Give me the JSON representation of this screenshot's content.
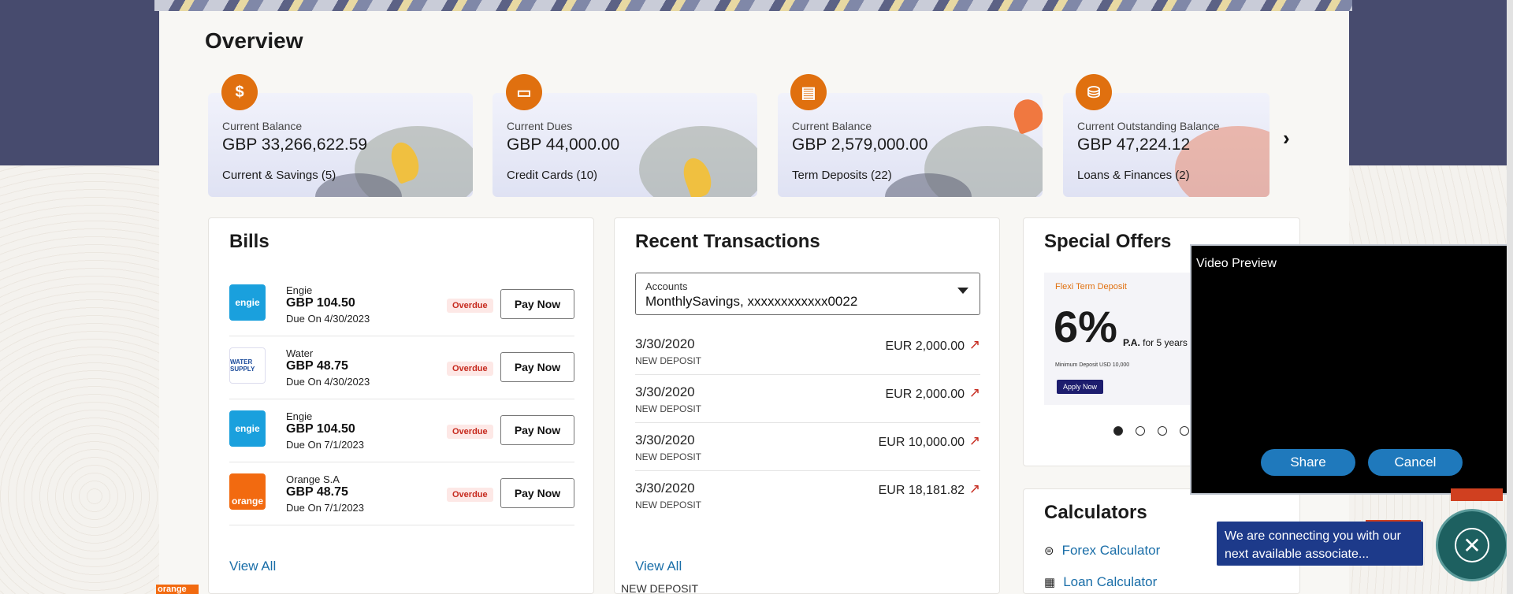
{
  "overview": {
    "title": "Overview",
    "cards": [
      {
        "icon": "dollar-coin-icon",
        "label": "Current Balance",
        "amount": "GBP 33,266,622.59",
        "category": "Current & Savings (5)"
      },
      {
        "icon": "credit-card-icon",
        "label": "Current Dues",
        "amount": "GBP 44,000.00",
        "category": "Credit Cards (10)"
      },
      {
        "icon": "term-deposit-icon",
        "label": "Current Balance",
        "amount": "GBP 2,579,000.00",
        "category": "Term Deposits (22)"
      },
      {
        "icon": "loan-hand-icon",
        "label": "Current Outstanding Balance",
        "amount": "GBP 47,224.12",
        "category": "Loans & Finances (2)"
      }
    ],
    "next_icon": "chevron-right-icon"
  },
  "bills": {
    "title": "Bills",
    "overdue_label": "Overdue",
    "pay_label": "Pay Now",
    "view_all": "View All",
    "items": [
      {
        "name": "Engie",
        "amount": "GBP 104.50",
        "due": "Due On 4/30/2023",
        "logo": "engie",
        "logo_color": "#1aa0dd"
      },
      {
        "name": "Water",
        "amount": "GBP 48.75",
        "due": "Due On 4/30/2023",
        "logo": "WATER SUPPLY",
        "logo_color": "#ffffff"
      },
      {
        "name": "Engie",
        "amount": "GBP 104.50",
        "due": "Due On 7/1/2023",
        "logo": "engie",
        "logo_color": "#1aa0dd"
      },
      {
        "name": "Orange S.A",
        "amount": "GBP 48.75",
        "due": "Due On 7/1/2023",
        "logo": "orange",
        "logo_color": "#f26a10"
      }
    ]
  },
  "transactions": {
    "title": "Recent Transactions",
    "accounts_label": "Accounts",
    "accounts_value": "MonthlySavings, xxxxxxxxxxxx0022",
    "view_all": "View All",
    "items": [
      {
        "date": "3/30/2020",
        "type": "NEW DEPOSIT",
        "amount": "EUR 2,000.00"
      },
      {
        "date": "3/30/2020",
        "type": "NEW DEPOSIT",
        "amount": "EUR 2,000.00"
      },
      {
        "date": "3/30/2020",
        "type": "NEW DEPOSIT",
        "amount": "EUR 10,000.00"
      },
      {
        "date": "3/30/2020",
        "type": "NEW DEPOSIT",
        "amount": "EUR 18,181.82"
      }
    ]
  },
  "offers": {
    "title": "Special Offers",
    "tag": "Flexi Term Deposit",
    "rate": "6%",
    "pa": "P.A.",
    "term": "for 5 years",
    "min_deposit": "Minimum Deposit USD 10,000",
    "apply": "Apply Now"
  },
  "calculators": {
    "title": "Calculators",
    "items": [
      "Forex Calculator",
      "Loan Calculator"
    ]
  },
  "video_preview": {
    "title": "Video Preview",
    "share": "Share",
    "cancel": "Cancel"
  },
  "chat": {
    "message": "We are connecting you with our next available associate..."
  },
  "peek": {
    "orange_logo": "orange",
    "deposit": "NEW DEPOSIT"
  },
  "colors": {
    "accent_orange": "#e0700f",
    "link_blue": "#1a6ea8",
    "overdue_red": "#c62a1e",
    "band": "#474b6e"
  }
}
